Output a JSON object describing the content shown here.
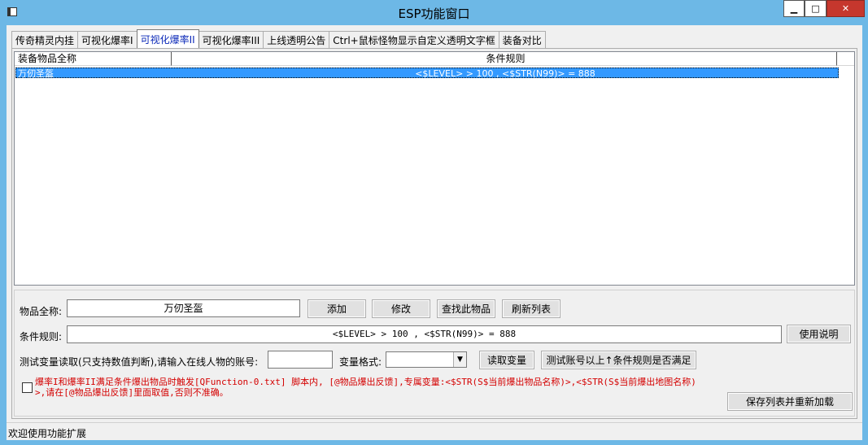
{
  "window": {
    "title": "ESP功能窗口",
    "min_glyph": "▁",
    "max_glyph": "□",
    "close_glyph": "✕"
  },
  "tabs": [
    {
      "label": "传奇精灵内挂",
      "active": false
    },
    {
      "label": "可视化爆率I",
      "active": false
    },
    {
      "label": "可视化爆率II",
      "active": true
    },
    {
      "label": "可视化爆率III",
      "active": false
    },
    {
      "label": "上线透明公告",
      "active": false
    },
    {
      "label": "Ctrl+鼠标怪物显示自定义透明文字框",
      "active": false
    },
    {
      "label": "装备对比",
      "active": false
    }
  ],
  "list": {
    "columns": [
      "装备物品全称",
      "条件规则",
      ""
    ],
    "rows": [
      {
        "name": "万仞圣盔",
        "rule": "<$LEVEL> > 100 , <$STR(N99)> = 888"
      }
    ]
  },
  "form": {
    "item_name_label": "物品全称:",
    "item_name_value": "万仞圣盔",
    "add_button": "添加",
    "modify_button": "修改",
    "find_button": "查找此物品",
    "refresh_button": "刷新列表",
    "rule_label": "条件规则:",
    "rule_value": "<$LEVEL> > 100 , <$STR(N99)> = 888",
    "help_button": "使用说明",
    "test_var_label": "测试变量读取(只支持数值判断),请输入在线人物的账号:",
    "account_value": "",
    "var_format_label": "变量格式:",
    "var_format_value": "",
    "read_var_button": "读取变量",
    "test_account_button": "测试账号以上↑条件规则是否满足",
    "note_line1": "爆率I和爆率II满足条件爆出物品时触发[QFunction-0.txt] 脚本内, [@物品爆出反馈],专属变量:<$STR(S$当前爆出物品名称)>,<$STR(S$当前爆出地图名称)",
    "note_line2": ">,请在[@物品爆出反馈]里面取值,否则不准确。",
    "save_button": "保存列表并重新加载"
  },
  "status": {
    "text": "欢迎使用功能扩展"
  }
}
